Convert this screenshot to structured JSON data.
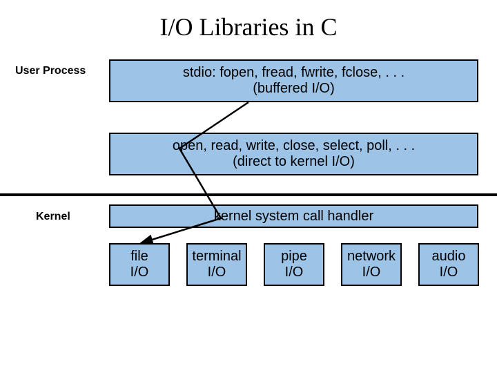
{
  "title": "I/O Libraries in C",
  "labels": {
    "user_process": "User Process",
    "kernel": "Kernel"
  },
  "layers": {
    "stdio": {
      "line1": "stdio: fopen, fread, fwrite, fclose, . . .",
      "line2": "(buffered I/O)"
    },
    "syscalls": {
      "line1": "open, read, write, close, select, poll, . . .",
      "line2": "(direct to kernel I/O)"
    },
    "handler": "kernel system call handler"
  },
  "io_targets": {
    "file": {
      "l1": "file",
      "l2": "I/O"
    },
    "terminal": {
      "l1": "terminal",
      "l2": "I/O"
    },
    "pipe": {
      "l1": "pipe",
      "l2": "I/O"
    },
    "network": {
      "l1": "network",
      "l2": "I/O"
    },
    "audio": {
      "l1": "audio",
      "l2": "I/O"
    }
  }
}
